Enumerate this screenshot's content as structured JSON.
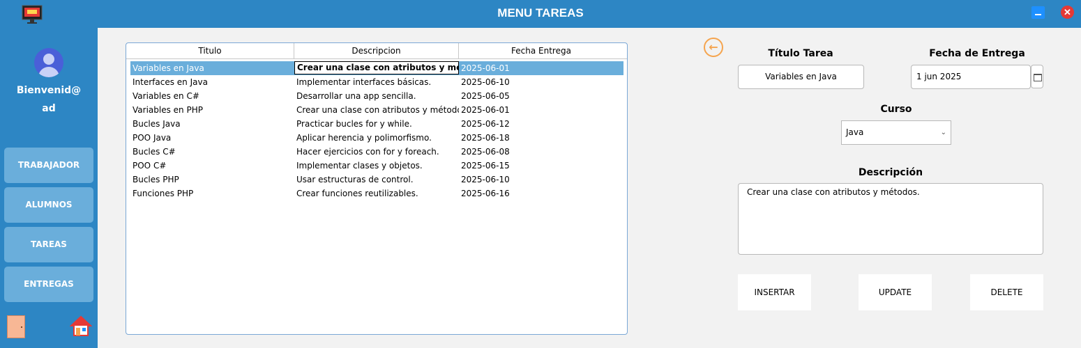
{
  "window": {
    "title": "MENU TAREAS",
    "minimize_icon": "minimize-icon",
    "close_label": "✕"
  },
  "sidebar": {
    "welcome_line1": "Bienvenid@",
    "welcome_line2": "ad",
    "nav": [
      {
        "label": "TRABAJADOR"
      },
      {
        "label": "ALUMNOS"
      },
      {
        "label": "TAREAS"
      },
      {
        "label": "ENTREGAS"
      }
    ],
    "logout_icon": "door-icon",
    "home_icon": "home-icon"
  },
  "table": {
    "columns": [
      "Titulo",
      "Descripcion",
      "Fecha Entrega"
    ],
    "rows": [
      {
        "titulo": "Variables en Java",
        "descripcion": "Crear una clase con atributos y métodos.",
        "fecha": "2025-06-01"
      },
      {
        "titulo": "Interfaces en Java",
        "descripcion": "Implementar interfaces básicas.",
        "fecha": "2025-06-10"
      },
      {
        "titulo": "Variables en C#",
        "descripcion": "Desarrollar una app sencilla.",
        "fecha": "2025-06-05"
      },
      {
        "titulo": "Variables en PHP",
        "descripcion": "Crear una clase con atributos y métodos.",
        "fecha": "2025-06-01"
      },
      {
        "titulo": "Bucles Java",
        "descripcion": "Practicar bucles for y while.",
        "fecha": "2025-06-12"
      },
      {
        "titulo": "POO Java",
        "descripcion": "Aplicar herencia y polimorfismo.",
        "fecha": "2025-06-18"
      },
      {
        "titulo": "Bucles C#",
        "descripcion": "Hacer ejercicios con for y foreach.",
        "fecha": "2025-06-08"
      },
      {
        "titulo": "POO C#",
        "descripcion": "Implementar clases y objetos.",
        "fecha": "2025-06-15"
      },
      {
        "titulo": "Bucles PHP",
        "descripcion": "Usar estructuras de control.",
        "fecha": "2025-06-10"
      },
      {
        "titulo": "Funciones PHP",
        "descripcion": "Crear funciones reutilizables.",
        "fecha": "2025-06-16"
      }
    ],
    "selected_row": 0
  },
  "form": {
    "back_icon": "arrow-left-icon",
    "titulo_label": "Título Tarea",
    "titulo_value": "Variables en Java",
    "fecha_label": "Fecha de Entrega",
    "fecha_value": "1 jun 2025",
    "curso_label": "Curso",
    "curso_value": "Java",
    "descripcion_label": "Descripción",
    "descripcion_value": "Crear una clase con atributos y métodos.",
    "buttons": {
      "insert": "INSERTAR",
      "update": "UPDATE",
      "delete": "DELETE"
    }
  },
  "colors": {
    "primary": "#2d86c4",
    "nav_button": "#6aaedb",
    "selected_row": "#6aaedb",
    "accent": "#f5a44e",
    "close": "#e53935"
  }
}
